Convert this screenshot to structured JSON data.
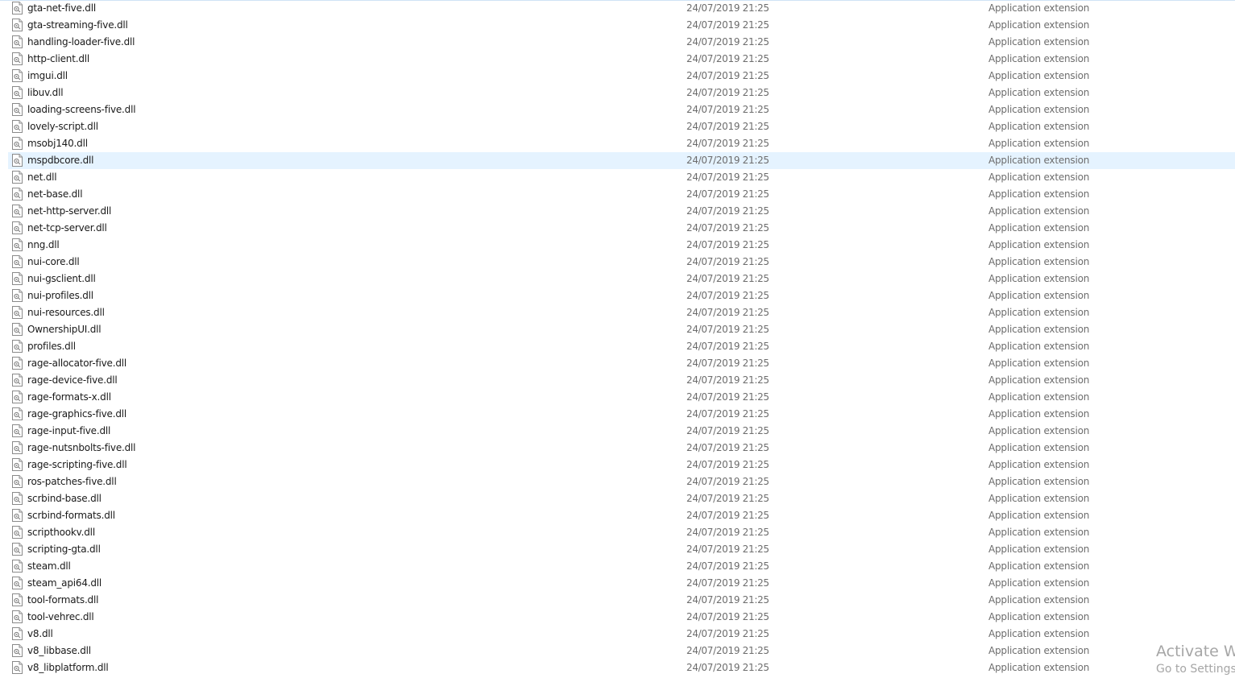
{
  "files": [
    {
      "name": "gta-net-five.dll",
      "date": "24/07/2019 21:25",
      "type": "Application extension"
    },
    {
      "name": "gta-streaming-five.dll",
      "date": "24/07/2019 21:25",
      "type": "Application extension"
    },
    {
      "name": "handling-loader-five.dll",
      "date": "24/07/2019 21:25",
      "type": "Application extension"
    },
    {
      "name": "http-client.dll",
      "date": "24/07/2019 21:25",
      "type": "Application extension"
    },
    {
      "name": "imgui.dll",
      "date": "24/07/2019 21:25",
      "type": "Application extension"
    },
    {
      "name": "libuv.dll",
      "date": "24/07/2019 21:25",
      "type": "Application extension"
    },
    {
      "name": "loading-screens-five.dll",
      "date": "24/07/2019 21:25",
      "type": "Application extension"
    },
    {
      "name": "lovely-script.dll",
      "date": "24/07/2019 21:25",
      "type": "Application extension"
    },
    {
      "name": "msobj140.dll",
      "date": "24/07/2019 21:25",
      "type": "Application extension"
    },
    {
      "name": "mspdbcore.dll",
      "date": "24/07/2019 21:25",
      "type": "Application extension"
    },
    {
      "name": "net.dll",
      "date": "24/07/2019 21:25",
      "type": "Application extension"
    },
    {
      "name": "net-base.dll",
      "date": "24/07/2019 21:25",
      "type": "Application extension"
    },
    {
      "name": "net-http-server.dll",
      "date": "24/07/2019 21:25",
      "type": "Application extension"
    },
    {
      "name": "net-tcp-server.dll",
      "date": "24/07/2019 21:25",
      "type": "Application extension"
    },
    {
      "name": "nng.dll",
      "date": "24/07/2019 21:25",
      "type": "Application extension"
    },
    {
      "name": "nui-core.dll",
      "date": "24/07/2019 21:25",
      "type": "Application extension"
    },
    {
      "name": "nui-gsclient.dll",
      "date": "24/07/2019 21:25",
      "type": "Application extension"
    },
    {
      "name": "nui-profiles.dll",
      "date": "24/07/2019 21:25",
      "type": "Application extension"
    },
    {
      "name": "nui-resources.dll",
      "date": "24/07/2019 21:25",
      "type": "Application extension"
    },
    {
      "name": "OwnershipUI.dll",
      "date": "24/07/2019 21:25",
      "type": "Application extension"
    },
    {
      "name": "profiles.dll",
      "date": "24/07/2019 21:25",
      "type": "Application extension"
    },
    {
      "name": "rage-allocator-five.dll",
      "date": "24/07/2019 21:25",
      "type": "Application extension"
    },
    {
      "name": "rage-device-five.dll",
      "date": "24/07/2019 21:25",
      "type": "Application extension"
    },
    {
      "name": "rage-formats-x.dll",
      "date": "24/07/2019 21:25",
      "type": "Application extension"
    },
    {
      "name": "rage-graphics-five.dll",
      "date": "24/07/2019 21:25",
      "type": "Application extension"
    },
    {
      "name": "rage-input-five.dll",
      "date": "24/07/2019 21:25",
      "type": "Application extension"
    },
    {
      "name": "rage-nutsnbolts-five.dll",
      "date": "24/07/2019 21:25",
      "type": "Application extension"
    },
    {
      "name": "rage-scripting-five.dll",
      "date": "24/07/2019 21:25",
      "type": "Application extension"
    },
    {
      "name": "ros-patches-five.dll",
      "date": "24/07/2019 21:25",
      "type": "Application extension"
    },
    {
      "name": "scrbind-base.dll",
      "date": "24/07/2019 21:25",
      "type": "Application extension"
    },
    {
      "name": "scrbind-formats.dll",
      "date": "24/07/2019 21:25",
      "type": "Application extension"
    },
    {
      "name": "scripthookv.dll",
      "date": "24/07/2019 21:25",
      "type": "Application extension"
    },
    {
      "name": "scripting-gta.dll",
      "date": "24/07/2019 21:25",
      "type": "Application extension"
    },
    {
      "name": "steam.dll",
      "date": "24/07/2019 21:25",
      "type": "Application extension"
    },
    {
      "name": "steam_api64.dll",
      "date": "24/07/2019 21:25",
      "type": "Application extension"
    },
    {
      "name": "tool-formats.dll",
      "date": "24/07/2019 21:25",
      "type": "Application extension"
    },
    {
      "name": "tool-vehrec.dll",
      "date": "24/07/2019 21:25",
      "type": "Application extension"
    },
    {
      "name": "v8.dll",
      "date": "24/07/2019 21:25",
      "type": "Application extension"
    },
    {
      "name": "v8_libbase.dll",
      "date": "24/07/2019 21:25",
      "type": "Application extension"
    },
    {
      "name": "v8_libplatform.dll",
      "date": "24/07/2019 21:25",
      "type": "Application extension"
    }
  ],
  "selected_file": "mspdbcore.dll",
  "file_icon": "dll-file-icon",
  "colors": {
    "selection": "#e5f3ff",
    "secondary_text": "#6d6d6d",
    "watermark_text": "#a6a6a6"
  },
  "watermark": {
    "title": "Activate Wi",
    "subtitle": "Go to Settings"
  }
}
